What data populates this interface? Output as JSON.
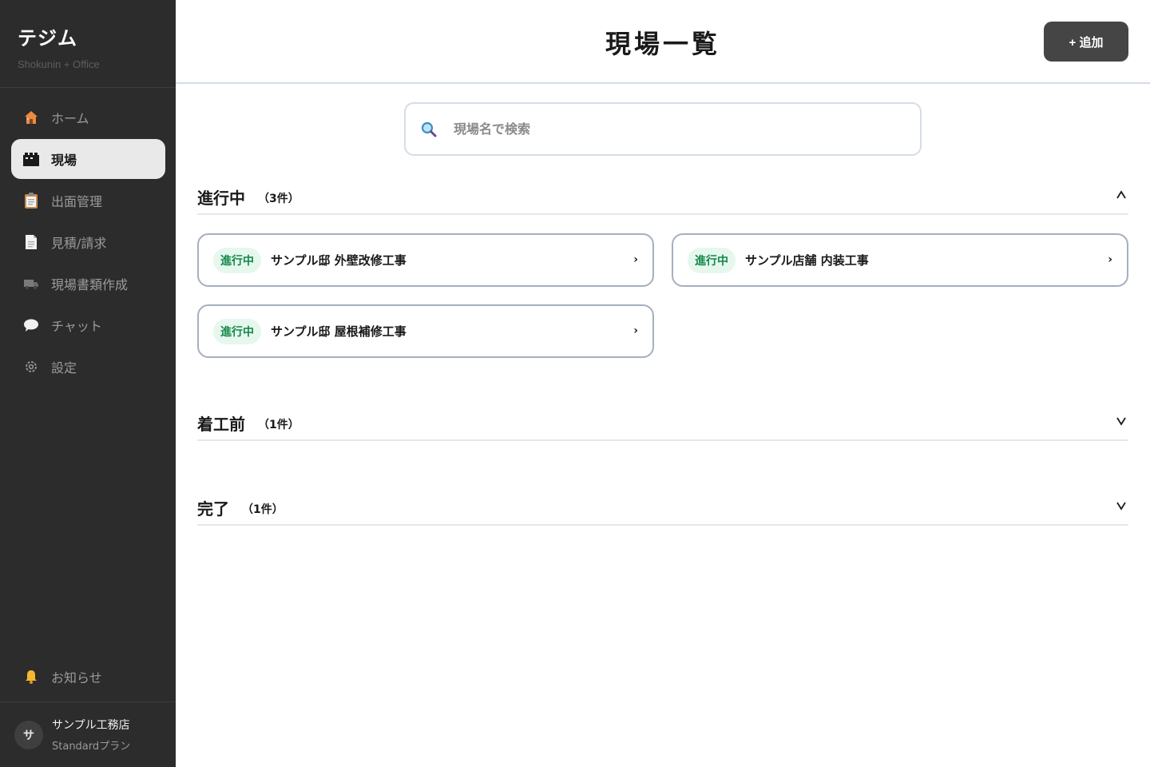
{
  "sidebar": {
    "brand_title": "テジム",
    "brand_subtitle": "Shokunin + Office",
    "items": [
      {
        "label": "ホーム",
        "icon": "house-icon"
      },
      {
        "label": "現場",
        "icon": "site-icon"
      },
      {
        "label": "出面管理",
        "icon": "clipboard-icon"
      },
      {
        "label": "見積/請求",
        "icon": "document-icon"
      },
      {
        "label": "現場書類作成",
        "icon": "truck-icon"
      },
      {
        "label": "チャット",
        "icon": "speech-bubble-icon"
      },
      {
        "label": "設定",
        "icon": "gear-icon"
      }
    ],
    "active_index": 1,
    "notifications_label": "お知らせ",
    "account": {
      "avatar": "サ",
      "name": "サンプル工務店",
      "plan": "Standardプラン"
    }
  },
  "header": {
    "title": "現場一覧",
    "add_button": "+ 追加"
  },
  "search": {
    "placeholder": "現場名で検索",
    "value": ""
  },
  "sections": [
    {
      "title": "進行中",
      "count": "（3件）",
      "expanded": true,
      "toggle": "^",
      "cards": [
        {
          "status": "進行中",
          "name": "サンプル邸 外壁改修工事"
        },
        {
          "status": "進行中",
          "name": "サンプル店舗 内装工事"
        },
        {
          "status": "進行中",
          "name": "サンプル邸 屋根補修工事"
        }
      ]
    },
    {
      "title": "着工前",
      "count": "（1件）",
      "expanded": false,
      "toggle": "v"
    },
    {
      "title": "完了",
      "count": "（1件）",
      "expanded": false,
      "toggle": "v"
    }
  ],
  "card_arrow": "›",
  "colors": {
    "sidebar_bg": "#2c2c2c",
    "active_item_bg": "#e9e9e9",
    "badge_bg": "#e6f7ee",
    "badge_text": "#13874a",
    "add_button_bg": "#454545"
  }
}
